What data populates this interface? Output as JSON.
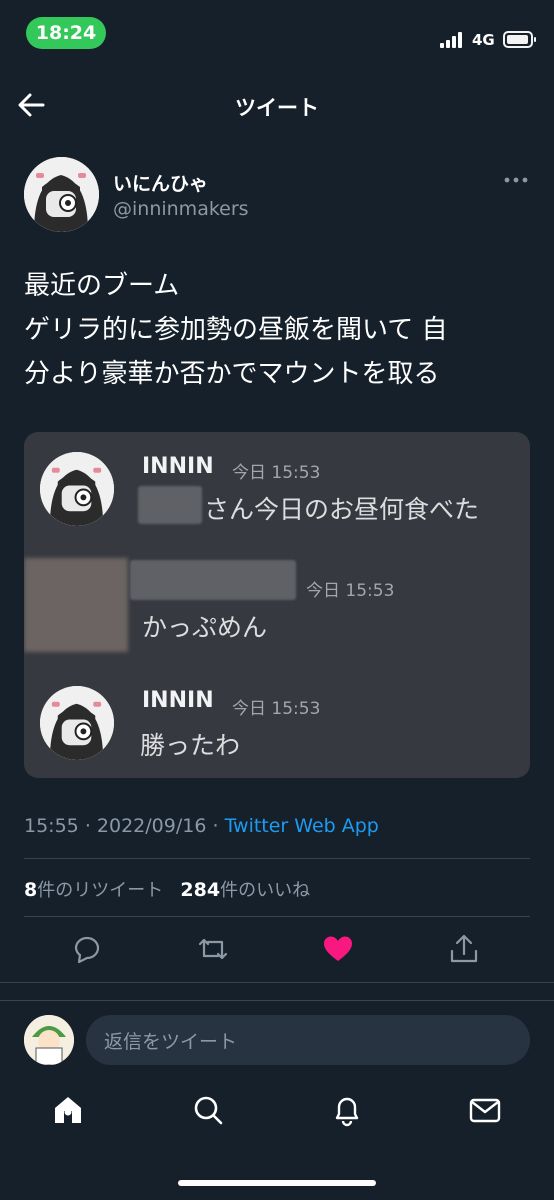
{
  "status_bar": {
    "time": "18:24",
    "network": "4G"
  },
  "header": {
    "title": "ツイート"
  },
  "author": {
    "display_name": "いにんひゃ",
    "username": "@inninmakers"
  },
  "tweet": {
    "lines": [
      "最近のブーム",
      "ゲリラ的に参加勢の昼飯を聞いて 自",
      "分より豪華か否かでマウントを取る"
    ]
  },
  "embed": {
    "messages": [
      {
        "name": "INNIN",
        "time": "今日 15:53",
        "text": "さん今日のお昼何食べた"
      },
      {
        "name": "",
        "time": "今日 15:53",
        "text": "かっぷめん"
      },
      {
        "name": "INNIN",
        "time": "今日 15:53",
        "text": "勝ったわ"
      }
    ]
  },
  "meta": {
    "time": "15:55",
    "date": "2022/09/16",
    "separator": "·",
    "source": "Twitter Web App"
  },
  "stats": {
    "retweets_count": "8",
    "retweets_label": "件のリツイート",
    "likes_count": "284",
    "likes_label": "件のいいね"
  },
  "actions": {
    "liked": true,
    "like_color": "#f91880"
  },
  "reply": {
    "placeholder": "返信をツイート"
  },
  "colors": {
    "background": "#15202b",
    "accent": "#1d9bf0",
    "muted": "#8b98a5"
  },
  "tabs": [
    "home-icon",
    "search-icon",
    "notifications-icon",
    "messages-icon"
  ]
}
